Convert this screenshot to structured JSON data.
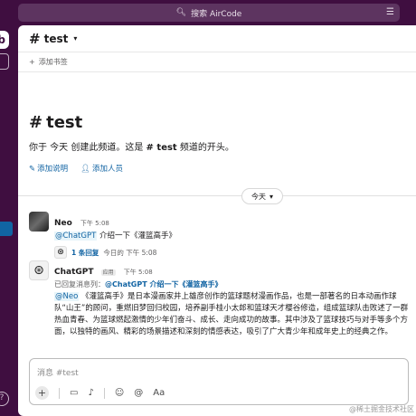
{
  "search": {
    "label": "搜索 AirCode",
    "icon": "search-icon"
  },
  "workspace": {
    "initial": "b"
  },
  "channel": {
    "hash": "#",
    "name": "test"
  },
  "bookmarks": {
    "add_label": "添加书签"
  },
  "intro": {
    "hash": "#",
    "title": "test",
    "desc_prefix": "你于 今天 创建此频道。这是 ",
    "desc_channel": "# test",
    "desc_suffix": " 频道的开头。",
    "add_description": "添加说明",
    "add_people": "添加人员"
  },
  "day_divider": {
    "label": "今天"
  },
  "messages": [
    {
      "author": "Neo",
      "time": "下午 5:08",
      "mention": "@ChatGPT",
      "text": " 介绍一下《灌篮高手》",
      "thread": {
        "replies": "1 条回复",
        "when": "今日的 下午 5:08"
      }
    },
    {
      "author": "ChatGPT",
      "app_tag": "应用",
      "time": "下午 5:08",
      "replied_prefix": "已回复消息列：",
      "replied_quote": "@ChatGPT 介绍一下《灌篮高手》",
      "mention": "@Neo",
      "text": " 《灌篮高手》是日本漫画家井上雄彦创作的篮球题材漫画作品，也是一部著名的日本动画作球队“山王”的顾问，重燃旧梦回归校园，培养副手桂小太郎和篮球天才樱谷修造，组成篮球队击败述了一群热血青春、为篮球燃起激情的少年们奋斗、成长、走向成功的故事。其中涉及了篮球技巧与对手等多个方面，以独特的画风、精彩的场景描述和深刻的情感表达，吸引了广大青少年和成年史上的经典之作。"
    }
  ],
  "composer": {
    "placeholder": "消息 #test",
    "format_label": "Aa"
  },
  "watermark": "@稀土掘金技术社区"
}
